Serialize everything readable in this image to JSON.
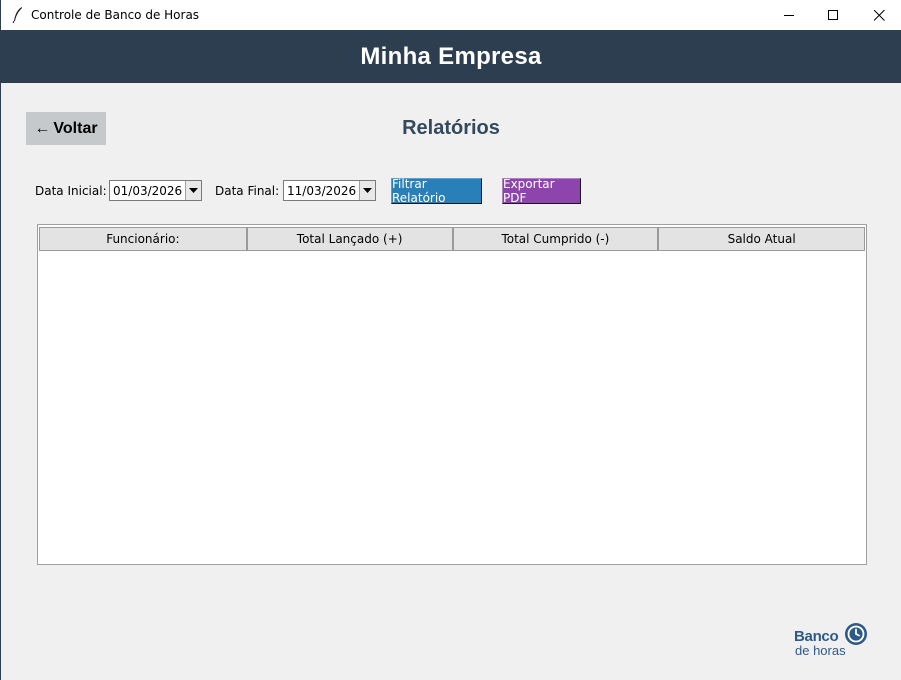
{
  "window": {
    "title": "Controle de Banco de Horas",
    "controls": [
      "minimize",
      "maximize",
      "close"
    ]
  },
  "header": {
    "company": "Minha Empresa"
  },
  "nav": {
    "back_label": "Voltar",
    "back_arrow": "←"
  },
  "page": {
    "title": "Relatórios"
  },
  "filters": {
    "start_label": "Data Inicial:",
    "start_value": "01/03/2026",
    "end_label": "Data Final:",
    "end_value": "11/03/2026",
    "filter_button": "Filtrar Relatório",
    "export_button": "Exportar PDF"
  },
  "table": {
    "columns": [
      "Funcionário:",
      "Total Lançado (+)",
      "Total Cumprido (-)",
      "Saldo Atual"
    ],
    "rows": []
  },
  "logo": {
    "line1": "Banco",
    "line2": "de horas"
  },
  "colors": {
    "header_bg": "#2c3e50",
    "title_color": "#34495e",
    "filter_button": "#2980b9",
    "export_button": "#8e44ad",
    "logo": "#2e5a8a"
  }
}
